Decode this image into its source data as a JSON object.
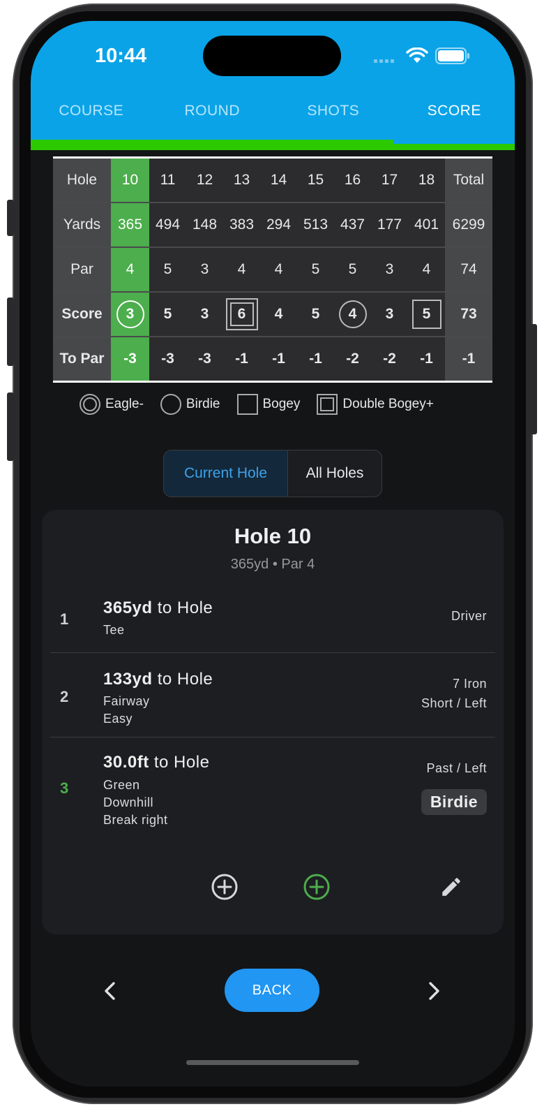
{
  "status": {
    "time": "10:44"
  },
  "tabs": [
    "COURSE",
    "ROUND",
    "SHOTS",
    "SCORE"
  ],
  "scorecard": {
    "rows": [
      {
        "label": "Hole",
        "cells": [
          "10",
          "11",
          "12",
          "13",
          "14",
          "15",
          "16",
          "17",
          "18"
        ],
        "total": "Total"
      },
      {
        "label": "Yards",
        "cells": [
          "365",
          "494",
          "148",
          "383",
          "294",
          "513",
          "437",
          "177",
          "401"
        ],
        "total": "6299"
      },
      {
        "label": "Par",
        "cells": [
          "4",
          "5",
          "3",
          "4",
          "4",
          "5",
          "5",
          "3",
          "4"
        ],
        "total": "74"
      },
      {
        "label": "Score",
        "cells": [
          "3",
          "5",
          "3",
          "6",
          "4",
          "5",
          "4",
          "3",
          "5"
        ],
        "total": "73"
      },
      {
        "label": "To Par",
        "cells": [
          "-3",
          "-3",
          "-3",
          "-1",
          "-1",
          "-1",
          "-2",
          "-2",
          "-1"
        ],
        "total": "-1"
      }
    ]
  },
  "legend": {
    "eagle": "Eagle-",
    "birdie": "Birdie",
    "bogey": "Bogey",
    "double_bogey": "Double Bogey+"
  },
  "segmented": {
    "current": "Current Hole",
    "all": "All Holes"
  },
  "hole": {
    "title": "Hole 10",
    "subtitle": "365yd • Par 4",
    "shots": [
      {
        "num": "1",
        "distance": "365yd",
        "to": " to Hole",
        "lines": [
          "Tee"
        ],
        "right": [
          "Driver"
        ]
      },
      {
        "num": "2",
        "distance": "133yd",
        "to": " to Hole",
        "lines": [
          "Fairway",
          "Easy"
        ],
        "right": [
          "7 Iron",
          "Short / Left"
        ]
      },
      {
        "num": "3",
        "distance": "30.0ft",
        "to": " to Hole",
        "lines": [
          "Green",
          "Downhill",
          "Break right"
        ],
        "right": [
          "Past / Left"
        ],
        "badge": "Birdie"
      }
    ]
  },
  "footer": {
    "back": "BACK"
  },
  "colors": {
    "header": "#0aa3e8",
    "progress": "#2cc800",
    "current_hole": "#4cae4c",
    "accent": "#2196f3"
  }
}
